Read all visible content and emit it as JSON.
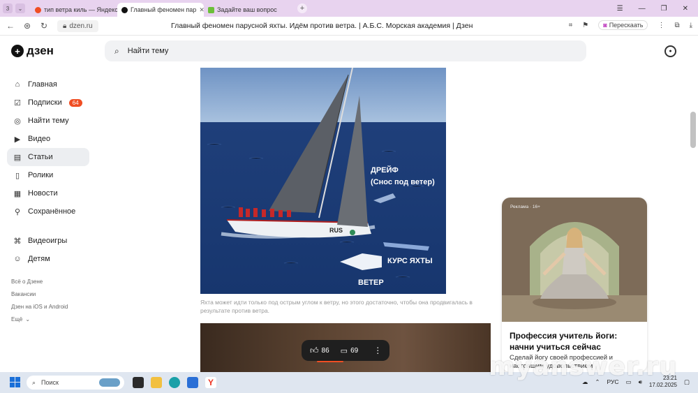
{
  "browser": {
    "tab_counter": "3",
    "tabs": [
      {
        "label": "тип ветра киль — Яндекс",
        "favicon_color": "#f04e23",
        "active": false
      },
      {
        "label": "Главный феномен пар",
        "favicon_color": "#111111",
        "active": true
      },
      {
        "label": "Задайте ваш вопрос",
        "favicon_color": "#6cbf3a",
        "active": false
      }
    ],
    "new_tab_icon": "plus-icon",
    "url": "dzen.ru",
    "page_title": "Главный феномен парусной яхты. Идём против ветра. | А.Б.С. Морская академия | Дзен",
    "retell_label": "Перескаать"
  },
  "dzen": {
    "logo_text": "дзен",
    "search_placeholder": "Найти тему"
  },
  "sidebar": {
    "items": [
      {
        "label": "Главная",
        "icon": "home-icon"
      },
      {
        "label": "Подписки",
        "icon": "subscriptions-icon",
        "badge": "64"
      },
      {
        "label": "Найти тему",
        "icon": "compass-icon"
      },
      {
        "label": "Видео",
        "icon": "video-icon"
      },
      {
        "label": "Статьи",
        "icon": "articles-icon",
        "active": true
      },
      {
        "label": "Ролики",
        "icon": "shorts-icon"
      },
      {
        "label": "Новости",
        "icon": "news-icon"
      },
      {
        "label": "Сохранённое",
        "icon": "bookmark-icon"
      }
    ],
    "items2": [
      {
        "label": "Видеоигры",
        "icon": "gamepad-icon"
      },
      {
        "label": "Детям",
        "icon": "kids-icon"
      }
    ],
    "links": [
      "Всё о Дзене",
      "Вакансии",
      "Дзен на iOS и Android",
      "Ещё"
    ]
  },
  "article": {
    "image_labels": {
      "drift": "ДРЕЙФ",
      "drift_sub": "(Снос под ветер)",
      "course": "КУРС ЯХТЫ",
      "wind": "ВЕТЕР",
      "hull": "RUS"
    },
    "caption": "Яхта может идти только под острым углом к ветру, но этого достаточно, чтобы она продвигалась в результате против ветра.",
    "likes": "86",
    "comments": "69"
  },
  "ad": {
    "label": "Реклама · 16+",
    "title": "Профессия учитель йоги: начни учиться сейчас",
    "text": "Сделай йогу своей профессией и настоящим удовольствием"
  },
  "taskbar": {
    "search_label": "Поиск",
    "lang": "РУС",
    "time": "23:21",
    "date": "17.02.2025"
  },
  "watermark": "myanswer.ru"
}
